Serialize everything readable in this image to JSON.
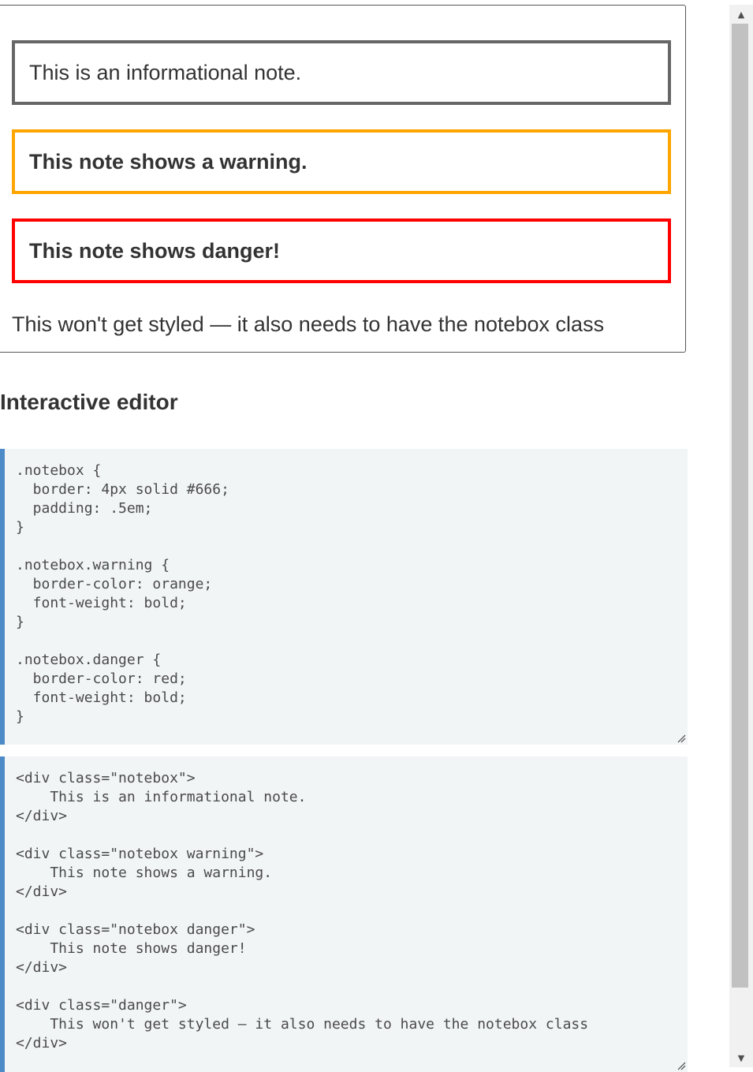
{
  "output": {
    "info_note": "This is an informational note.",
    "warning_note": "This note shows a warning.",
    "danger_note": "This note shows danger!",
    "plain_text": "This won't get styled — it also needs to have the notebox class"
  },
  "editor": {
    "heading": "Interactive editor",
    "css_code": ".notebox {\n  border: 4px solid #666;\n  padding: .5em;\n}\n\n.notebox.warning {\n  border-color: orange;\n  font-weight: bold;\n}\n\n.notebox.danger {\n  border-color: red;\n  font-weight: bold;\n}",
    "html_code": "<div class=\"notebox\">\n    This is an informational note.\n</div>\n\n<div class=\"notebox warning\">\n    This note shows a warning.\n</div>\n\n<div class=\"notebox danger\">\n    This note shows danger!\n</div>\n\n<div class=\"danger\">\n    This won't get styled — it also needs to have the notebox class\n</div>"
  },
  "colors": {
    "info_border": "#666666",
    "warning_border": "#ffa500",
    "danger_border": "#ff0000",
    "editor_accent": "#4c8bc8",
    "editor_background": "#f2f5f6"
  },
  "icons": {
    "scroll_up": "scroll-up-arrow-icon",
    "scroll_down": "scroll-down-arrow-icon",
    "resize": "resize-grip-icon"
  }
}
